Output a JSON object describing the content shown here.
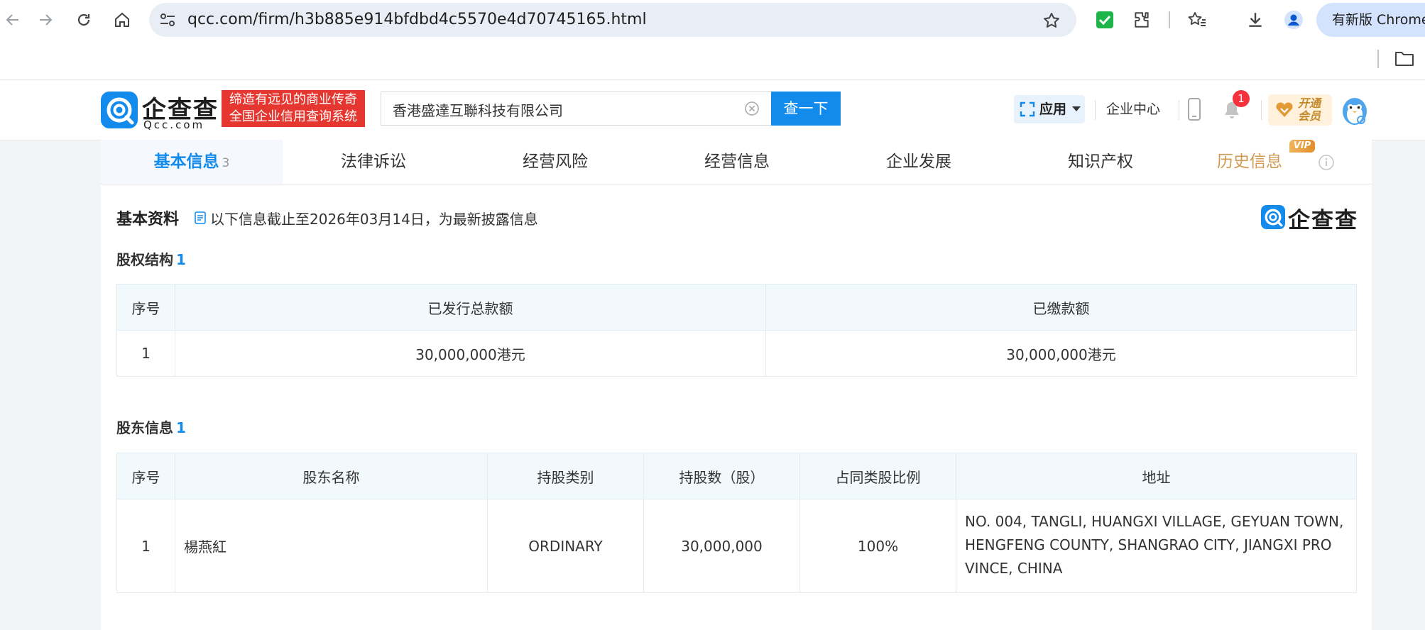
{
  "browser": {
    "url": "qcc.com/firm/h3b885e914bfdbd4c5570e4d70745165.html",
    "update_label": "有新版 Chrome"
  },
  "header": {
    "brand": "企查查",
    "brand_sub": "Qcc.com",
    "slogan_line1": "缔造有远见的商业传奇",
    "slogan_line2": "全国企业信用查询系统",
    "search_value": "香港盛達互聯科技有限公司",
    "search_button": "查一下",
    "apps_label": "应用",
    "enterprise_center": "企业中心",
    "notification_count": "1",
    "vip_line1": "开通",
    "vip_line2": "会员"
  },
  "tabs": [
    {
      "label": "基本信息",
      "count": "3"
    },
    {
      "label": "法律诉讼"
    },
    {
      "label": "经营风险"
    },
    {
      "label": "经营信息"
    },
    {
      "label": "企业发展"
    },
    {
      "label": "知识产权"
    },
    {
      "label": "历史信息",
      "tag": "VIP"
    }
  ],
  "basic": {
    "title": "基本资料",
    "note": "以下信息截止至2026年03月14日，为最新披露信息",
    "logo_text": "企查查"
  },
  "equity": {
    "title": "股权结构",
    "count": "1",
    "headers": [
      "序号",
      "已发行总款额",
      "已缴款额"
    ],
    "rows": [
      [
        "1",
        "30,000,000港元",
        "30,000,000港元"
      ]
    ]
  },
  "shareholders": {
    "title": "股东信息",
    "count": "1",
    "headers": [
      "序号",
      "股东名称",
      "持股类别",
      "持股数（股）",
      "占同类股比例",
      "地址"
    ],
    "rows": [
      {
        "no": "1",
        "name": "楊燕紅",
        "class": "ORDINARY",
        "shares": "30,000,000",
        "ratio": "100%",
        "addr_line1": "NO. 004, TANGLI, HUANGXI VILLAGE, GEYUAN TOWN,",
        "addr_line2": "HENGFENG COUNTY, SHANGRAO CITY, JIANGXI PRO",
        "addr_line3": "VINCE, CHINA"
      }
    ]
  },
  "colors": {
    "accent": "#128bed",
    "slogan_bg": "#e5372f",
    "table_header_bg": "#f2f9fc",
    "history_tab": "#d19a54"
  }
}
